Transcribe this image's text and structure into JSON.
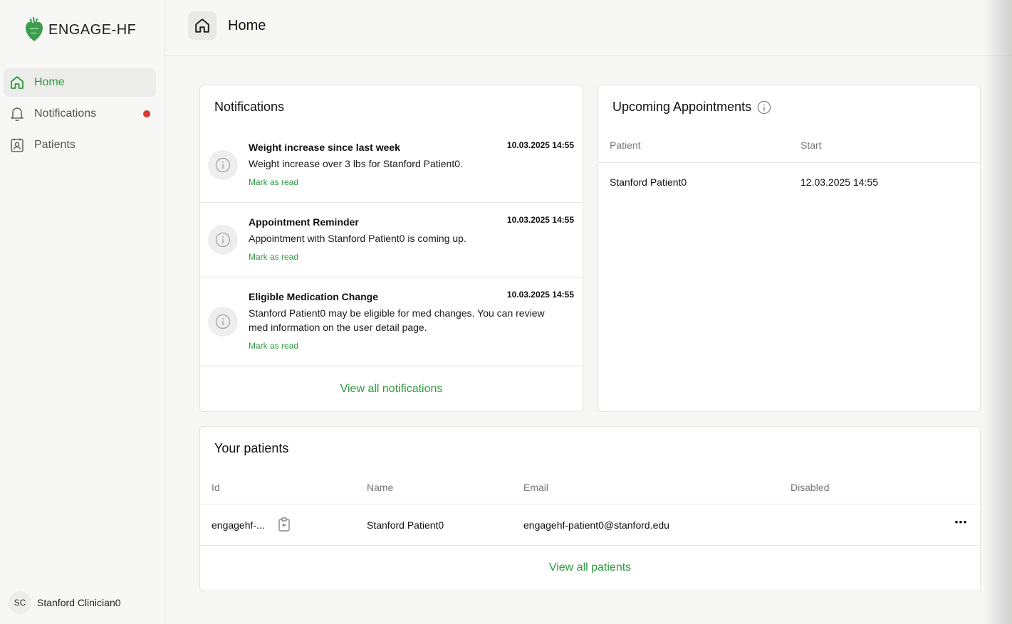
{
  "app": {
    "name": "ENGAGE-HF",
    "brand_color": "#2e9a3d",
    "alert_color": "#d63a2f"
  },
  "sidebar": {
    "items": [
      {
        "label": "Home",
        "icon": "home-icon",
        "active": true
      },
      {
        "label": "Notifications",
        "icon": "bell-icon",
        "has_unread": true
      },
      {
        "label": "Patients",
        "icon": "contact-icon"
      }
    ],
    "user": {
      "initials": "SC",
      "name": "Stanford Clinician0"
    }
  },
  "header": {
    "title": "Home",
    "icon": "home-icon"
  },
  "notifications": {
    "title": "Notifications",
    "items": [
      {
        "title": "Weight increase since last week",
        "time": "10.03.2025 14:55",
        "message": "Weight increase over 3 lbs for Stanford Patient0.",
        "action": "Mark as read",
        "icon": "info-icon"
      },
      {
        "title": "Appointment Reminder",
        "time": "10.03.2025 14:55",
        "message": "Appointment with Stanford Patient0 is coming up.",
        "action": "Mark as read",
        "icon": "info-icon"
      },
      {
        "title": "Eligible Medication Change",
        "time": "10.03.2025 14:55",
        "message": "Stanford Patient0 may be eligible for med changes. You can review med information on the user detail page.",
        "action": "Mark as read",
        "icon": "info-icon"
      }
    ],
    "view_all": "View all notifications"
  },
  "appointments": {
    "title": "Upcoming Appointments",
    "columns": [
      "Patient",
      "Start"
    ],
    "rows": [
      {
        "patient": "Stanford Patient0",
        "start": "12.03.2025 14:55"
      }
    ]
  },
  "patients": {
    "title": "Your patients",
    "columns": [
      "Id",
      "Name",
      "Email",
      "Disabled"
    ],
    "rows": [
      {
        "id": "engagehf-...",
        "name": "Stanford Patient0",
        "email": "engagehf-patient0@stanford.edu",
        "disabled": "",
        "actions": "⋯"
      }
    ],
    "view_all": "View all patients"
  }
}
